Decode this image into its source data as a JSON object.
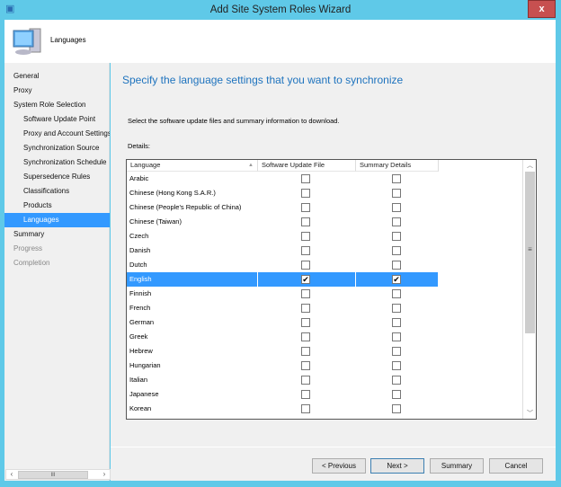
{
  "window": {
    "title": "Add Site System Roles Wizard",
    "close": "x"
  },
  "header": {
    "title": "Languages"
  },
  "nav": [
    {
      "label": "General",
      "level": 0,
      "state": "normal"
    },
    {
      "label": "Proxy",
      "level": 0,
      "state": "normal"
    },
    {
      "label": "System Role Selection",
      "level": 0,
      "state": "normal"
    },
    {
      "label": "Software Update Point",
      "level": 1,
      "state": "normal"
    },
    {
      "label": "Proxy and Account Settings",
      "level": 1,
      "state": "normal"
    },
    {
      "label": "Synchronization Source",
      "level": 1,
      "state": "normal"
    },
    {
      "label": "Synchronization Schedule",
      "level": 1,
      "state": "normal"
    },
    {
      "label": "Supersedence Rules",
      "level": 1,
      "state": "normal"
    },
    {
      "label": "Classifications",
      "level": 1,
      "state": "normal"
    },
    {
      "label": "Products",
      "level": 1,
      "state": "normal"
    },
    {
      "label": "Languages",
      "level": 1,
      "state": "selected"
    },
    {
      "label": "Summary",
      "level": 0,
      "state": "normal"
    },
    {
      "label": "Progress",
      "level": 0,
      "state": "disabled"
    },
    {
      "label": "Completion",
      "level": 0,
      "state": "disabled"
    }
  ],
  "main": {
    "heading": "Specify the language settings that you want to synchronize",
    "instruction": "Select the software update files and summary information to download.",
    "details_label": "Details:",
    "columns": [
      "Language",
      "Software Update File",
      "Summary Details"
    ],
    "rows": [
      {
        "language": "Arabic",
        "file": false,
        "summary": false
      },
      {
        "language": "Chinese (Hong Kong S.A.R.)",
        "file": false,
        "summary": false
      },
      {
        "language": "Chinese (People's Republic of China)",
        "file": false,
        "summary": false
      },
      {
        "language": "Chinese (Taiwan)",
        "file": false,
        "summary": false
      },
      {
        "language": "Czech",
        "file": false,
        "summary": false
      },
      {
        "language": "Danish",
        "file": false,
        "summary": false
      },
      {
        "language": "Dutch",
        "file": false,
        "summary": false
      },
      {
        "language": "English",
        "file": true,
        "summary": true,
        "selected": true
      },
      {
        "language": "Finnish",
        "file": false,
        "summary": false
      },
      {
        "language": "French",
        "file": false,
        "summary": false
      },
      {
        "language": "German",
        "file": false,
        "summary": false
      },
      {
        "language": "Greek",
        "file": false,
        "summary": false
      },
      {
        "language": "Hebrew",
        "file": false,
        "summary": false
      },
      {
        "language": "Hungarian",
        "file": false,
        "summary": false
      },
      {
        "language": "Italian",
        "file": false,
        "summary": false
      },
      {
        "language": "Japanese",
        "file": false,
        "summary": false
      },
      {
        "language": "Korean",
        "file": false,
        "summary": false
      }
    ]
  },
  "buttons": {
    "previous": "< Previous",
    "next": "Next >",
    "summary": "Summary",
    "cancel": "Cancel"
  }
}
